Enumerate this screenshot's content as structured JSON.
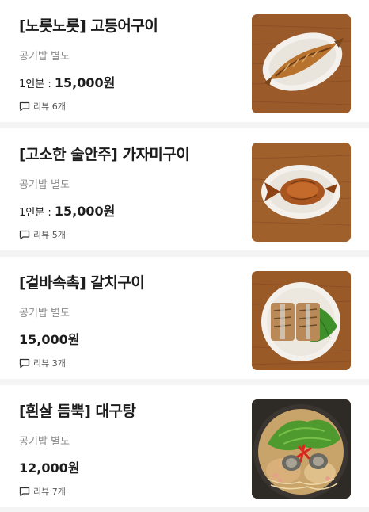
{
  "menu": {
    "items": [
      {
        "title": "[노릇노릇] 고등어구이",
        "subtitle": "공기밥 별도",
        "price_prefix": "1인분 : ",
        "price": "15,000원",
        "review_label": "리뷰 6개",
        "image": "grilled-mackerel-photo"
      },
      {
        "title": "[고소한 술안주]  가자미구이",
        "subtitle": "공기밥 별도",
        "price_prefix": "1인분 : ",
        "price": "15,000원",
        "review_label": "리뷰 5개",
        "image": "grilled-flounder-photo"
      },
      {
        "title": "[겉바속촉] 갈치구이",
        "subtitle": "공기밥 별도",
        "price_prefix": "",
        "price": "15,000원",
        "review_label": "리뷰 3개",
        "image": "grilled-hairtail-photo"
      },
      {
        "title": "[흰살 듬뿍] 대구탕",
        "subtitle": "공기밥 별도",
        "price_prefix": "",
        "price": "12,000원",
        "review_label": "리뷰 7개",
        "image": "cod-stew-photo"
      }
    ]
  },
  "icons": {
    "review": "speech-bubble-icon"
  },
  "colors": {
    "title": "#1c1c1c",
    "subtitle": "#8a8a8a",
    "divider": "#f4f4f4",
    "wood": "#9b5a2a"
  }
}
